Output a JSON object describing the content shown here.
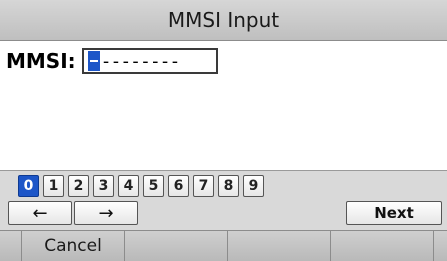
{
  "title": "MMSI Input",
  "mmsi": {
    "label": "MMSI:",
    "value": "--------"
  },
  "keypad": {
    "digits": [
      "0",
      "1",
      "2",
      "3",
      "4",
      "5",
      "6",
      "7",
      "8",
      "9"
    ],
    "selected_digit": "0",
    "left_arrow": "←",
    "right_arrow": "→",
    "next_label": "Next"
  },
  "softkeys": [
    "Cancel",
    "",
    "",
    ""
  ],
  "colors": {
    "accent": "#1d56c8",
    "title_bar": "#c8c8c8",
    "keypad_bg": "#d9d9d9"
  }
}
